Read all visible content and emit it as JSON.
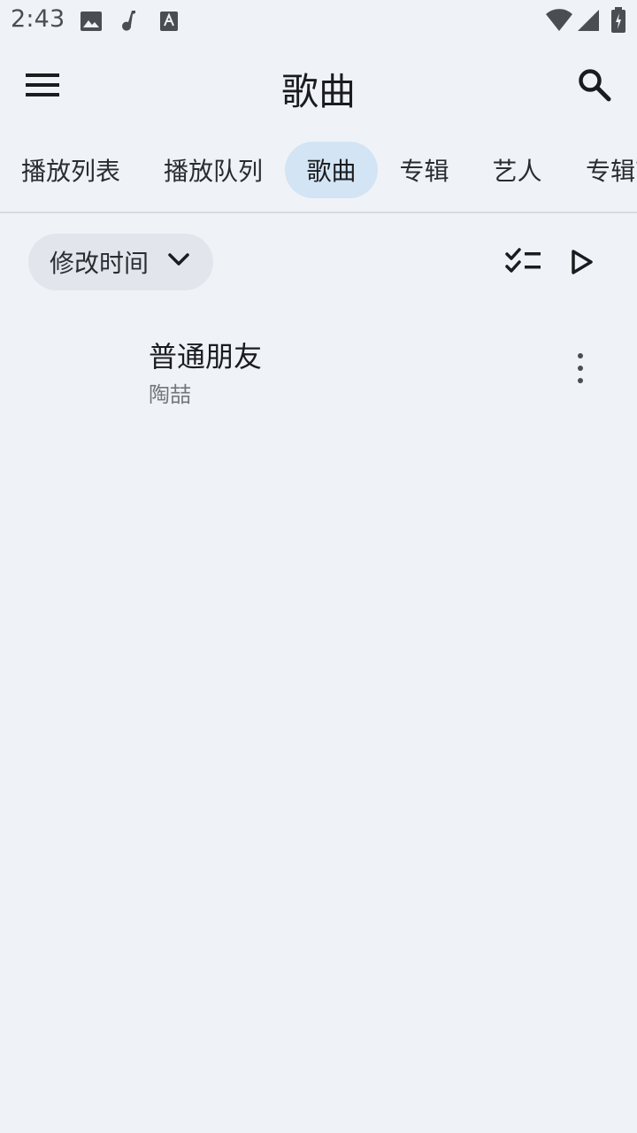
{
  "status_bar": {
    "time": "2:43",
    "icons": [
      "image-icon",
      "music-note-icon",
      "font-icon",
      "wifi-icon",
      "signal-icon",
      "battery-charging-icon"
    ]
  },
  "app_bar": {
    "title": "歌曲",
    "menu_icon": "menu-icon",
    "search_icon": "search-icon"
  },
  "tabs": [
    {
      "label": "播放列表",
      "selected": false
    },
    {
      "label": "播放队列",
      "selected": false
    },
    {
      "label": "歌曲",
      "selected": true
    },
    {
      "label": "专辑",
      "selected": false
    },
    {
      "label": "艺人",
      "selected": false
    },
    {
      "label": "专辑艺",
      "selected": false
    }
  ],
  "toolbar": {
    "sort_label": "修改时间",
    "sort_icon": "chevron-down-icon",
    "select_icon": "checklist-icon",
    "play_icon": "play-icon"
  },
  "songs": [
    {
      "title": "普通朋友",
      "artist": "陶喆"
    }
  ],
  "colors": {
    "background": "#eff3f8",
    "selected_tab": "#d3e4f4",
    "chip": "#e2e6ec",
    "text_primary": "#1b1c1f",
    "text_secondary": "#72767c"
  }
}
